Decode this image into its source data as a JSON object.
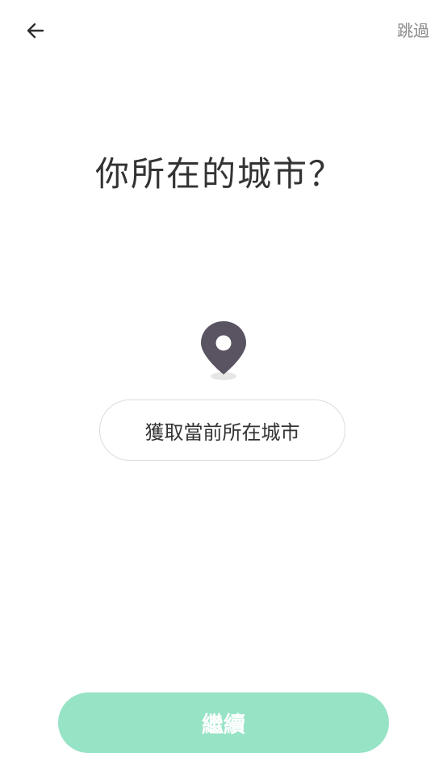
{
  "header": {
    "back_icon": "arrow-left-icon",
    "skip_label": "跳過"
  },
  "main": {
    "title": "你所在的城市？",
    "location_icon": "map-pin-icon",
    "detect_city_label": "獲取當前所在城市"
  },
  "footer": {
    "continue_label": "繼續"
  },
  "colors": {
    "accent": "#97e3c6",
    "pin": "#5a5462",
    "text": "#333333",
    "muted": "#8a8a8a"
  }
}
